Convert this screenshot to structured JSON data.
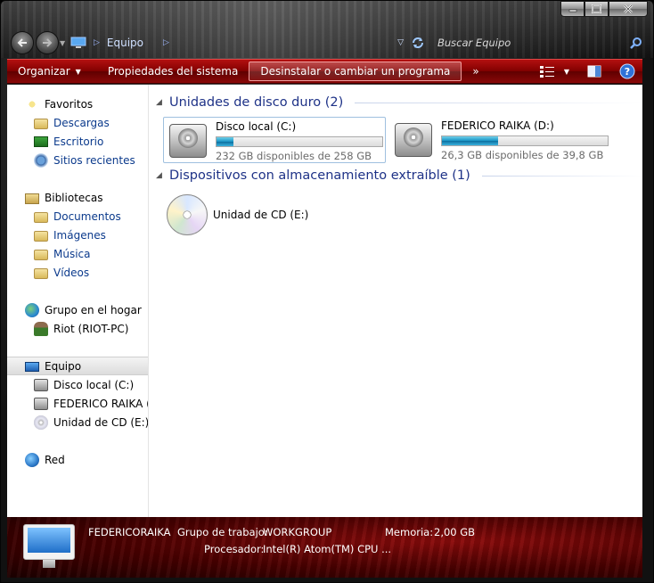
{
  "window": {
    "caption_buttons": [
      "minimize",
      "maximize",
      "close"
    ]
  },
  "address_bar": {
    "crumbs": [
      "Equipo"
    ],
    "search_placeholder": "Buscar Equipo"
  },
  "toolbar": {
    "organize": "Organizar",
    "system_properties": "Propiedades del sistema",
    "uninstall": "Desinstalar o cambiar un programa",
    "more": "»"
  },
  "sidebar": {
    "favorites": {
      "label": "Favoritos",
      "items": [
        "Descargas",
        "Escritorio",
        "Sitios recientes"
      ]
    },
    "libraries": {
      "label": "Bibliotecas",
      "items": [
        "Documentos",
        "Imágenes",
        "Música",
        "Vídeos"
      ]
    },
    "homegroup": "Grupo en el hogar",
    "user": "Riot (RIOT-PC)",
    "computer": {
      "label": "Equipo",
      "items": [
        "Disco local (C:)",
        "FEDERICO RAIKA (D:",
        "Unidad de CD (E:)"
      ]
    },
    "network": "Red"
  },
  "main": {
    "hard_drives": {
      "title": "Unidades de disco duro (2)",
      "drives": [
        {
          "name": "Disco local (C:)",
          "free": "232 GB disponibles de 258 GB",
          "used_fraction": 0.1
        },
        {
          "name": "FEDERICO RAIKA (D:)",
          "free": "26,3 GB disponibles de 39,8 GB",
          "used_fraction": 0.34
        }
      ]
    },
    "removable": {
      "title": "Dispositivos con almacenamiento extraíble (1)",
      "devices": [
        {
          "name": "Unidad de CD (E:)"
        }
      ]
    }
  },
  "details": {
    "computer_name": "FEDERICORAIKA",
    "workgroup_label": "Grupo de trabajo:",
    "workgroup": "WORKGROUP",
    "memory_label": "Memoria:",
    "memory": "2,00 GB",
    "processor_label": "Procesador:",
    "processor": "Intel(R) Atom(TM) CPU ..."
  },
  "colors": {
    "toolbar": "#8a0808",
    "link": "#0b3a8c",
    "section_title": "#1e3287",
    "progress": "#1893c4"
  }
}
